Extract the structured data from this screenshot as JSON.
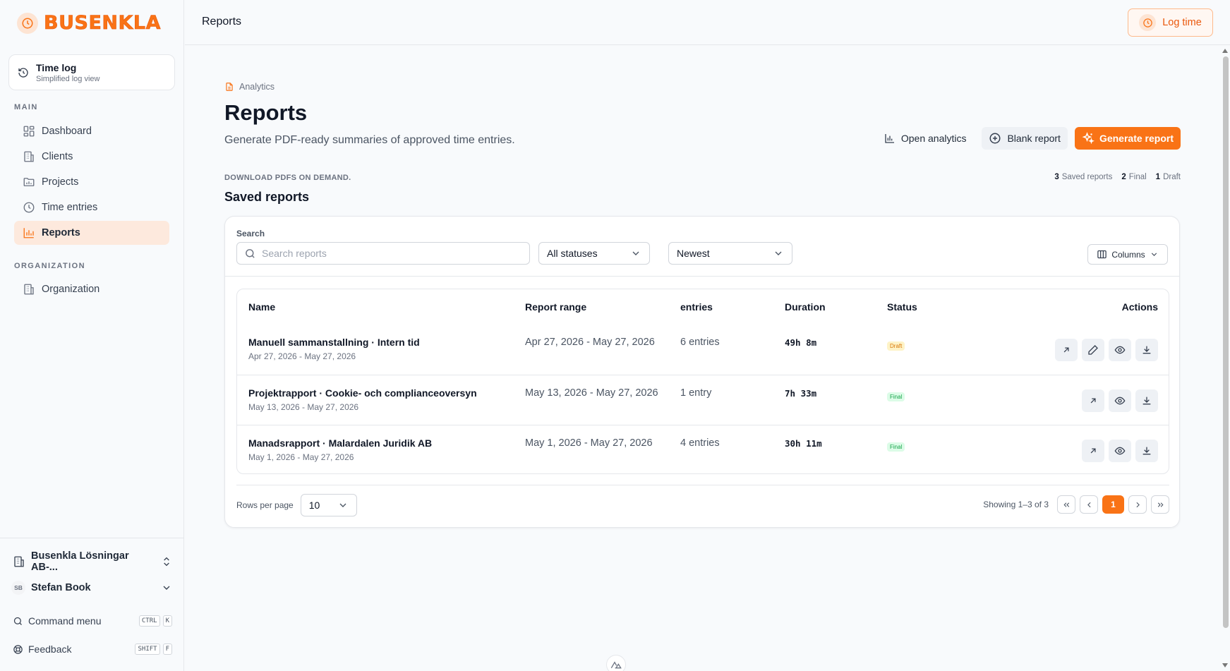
{
  "brand": {
    "name": "BUSENKLA",
    "accent": "#f97316"
  },
  "sidebar": {
    "timelog": {
      "title": "Time log",
      "subtitle": "Simplified log view"
    },
    "main_label": "MAIN",
    "items": [
      {
        "label": "Dashboard",
        "icon": "dashboard-icon"
      },
      {
        "label": "Clients",
        "icon": "building-icon"
      },
      {
        "label": "Projects",
        "icon": "folder-chart-icon"
      },
      {
        "label": "Time entries",
        "icon": "clock-icon"
      },
      {
        "label": "Reports",
        "icon": "bar-chart-icon",
        "active": true
      }
    ],
    "org_label": "ORGANIZATION",
    "org_items": [
      {
        "label": "Organization",
        "icon": "building-icon"
      }
    ],
    "org_switch": "Busenkla Lösningar AB-...",
    "user": {
      "initials": "SB",
      "name": "Stefan Book"
    },
    "command": {
      "label": "Command menu",
      "keys": [
        "CTRL",
        "K"
      ]
    },
    "feedback": {
      "label": "Feedback",
      "keys": [
        "SHIFT",
        "F"
      ]
    }
  },
  "topbar": {
    "title": "Reports",
    "log_time": "Log time"
  },
  "page": {
    "breadcrumb": "Analytics",
    "title": "Reports",
    "subtitle": "Generate PDF-ready summaries of approved time entries.",
    "actions": {
      "open_analytics": "Open analytics",
      "blank_report": "Blank report",
      "generate_report": "Generate report"
    },
    "eyebrow": "DOWNLOAD PDFS ON DEMAND.",
    "section_title": "Saved reports",
    "stats": [
      {
        "count": "3",
        "label": "Saved reports"
      },
      {
        "count": "2",
        "label": "Final"
      },
      {
        "count": "1",
        "label": "Draft"
      }
    ]
  },
  "filters": {
    "search_label": "Search",
    "search_placeholder": "Search reports",
    "search_value": "",
    "status": "All statuses",
    "sort": "Newest",
    "columns": "Columns"
  },
  "table": {
    "headers": {
      "name": "Name",
      "range": "Report range",
      "entries": "entries",
      "duration": "Duration",
      "status": "Status",
      "actions": "Actions"
    },
    "rows": [
      {
        "name": "Manuell sammanstallning · Intern tid",
        "sub": "Apr 27, 2026 - May 27, 2026",
        "range": "Apr 27, 2026 - May 27, 2026",
        "entries": "6 entries",
        "duration": "49h 8m",
        "status": "Draft",
        "actions": [
          "open-icon",
          "edit-icon",
          "eye-icon",
          "download-icon"
        ]
      },
      {
        "name": "Projektrapport · Cookie- och complianceoversyn",
        "sub": "May 13, 2026 - May 27, 2026",
        "range": "May 13, 2026 - May 27, 2026",
        "entries": "1 entry",
        "duration": "7h 33m",
        "status": "Final",
        "actions": [
          "open-icon",
          "eye-icon",
          "download-icon"
        ]
      },
      {
        "name": "Manadsrapport · Malardalen Juridik AB",
        "sub": "May 1, 2026 - May 27, 2026",
        "range": "May 1, 2026 - May 27, 2026",
        "entries": "4 entries",
        "duration": "30h 11m",
        "status": "Final",
        "actions": [
          "open-icon",
          "eye-icon",
          "download-icon"
        ]
      }
    ]
  },
  "pagination": {
    "rows_label": "Rows per page",
    "rows_value": "10",
    "showing": "Showing 1–3 of 3",
    "current_page": "1"
  }
}
